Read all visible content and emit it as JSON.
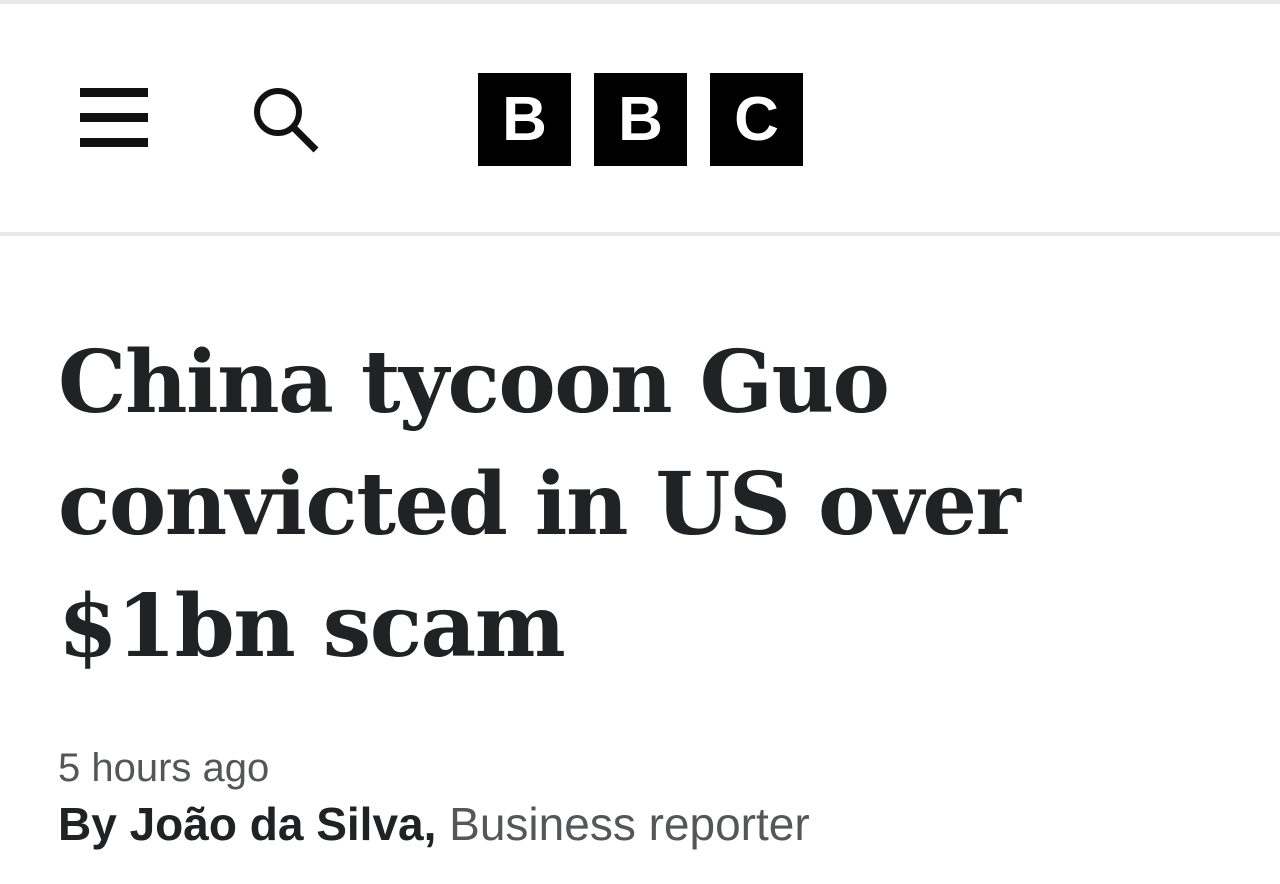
{
  "header": {
    "menu_icon": "hamburger-menu-icon",
    "search_icon": "search-icon",
    "logo_letters": [
      "B",
      "B",
      "C"
    ]
  },
  "article": {
    "headline": "China tycoon Guo convicted in US over $1bn scam",
    "timestamp": "5 hours ago",
    "byline": {
      "prefix": "By",
      "author": "João da Silva",
      "role": "Business reporter"
    }
  },
  "colors": {
    "logo_background": "#000000",
    "logo_text": "#ffffff",
    "headline_text": "#202224",
    "meta_text": "#545658",
    "divider": "#e6e8ea"
  }
}
